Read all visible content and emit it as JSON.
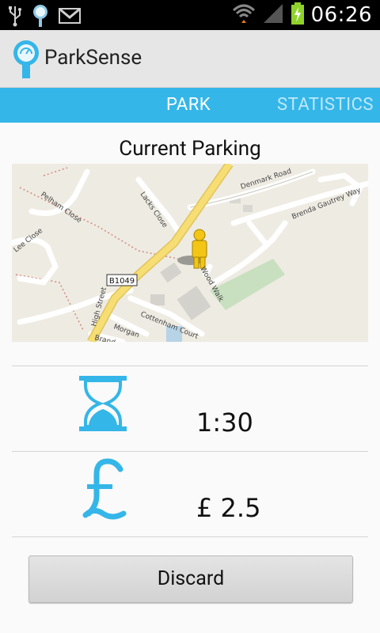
{
  "status_bar": {
    "time": "06:26",
    "icons": [
      "usb-icon",
      "parking-meter-notification-icon",
      "gmail-icon",
      "wifi-icon",
      "signal-icon",
      "battery-charging-icon"
    ]
  },
  "app": {
    "title": "ParkSense",
    "accent_color": "#35b6e8"
  },
  "tabs": [
    {
      "label": "PARK",
      "selected": true
    },
    {
      "label": "STATISTICS",
      "selected": false
    }
  ],
  "main": {
    "section_title": "Current Parking",
    "map": {
      "labels": [
        "Denmark Road",
        "Brenda Gautrey Way",
        "Lacks Close",
        "Pelham Close",
        "Lee Close",
        "B1049",
        "High Street",
        "Cottenham Court",
        "Morgan",
        "Brand",
        "Wood Walk"
      ]
    },
    "time_remaining": "1:30",
    "cost": "£ 2.5",
    "discard_label": "Discard"
  }
}
